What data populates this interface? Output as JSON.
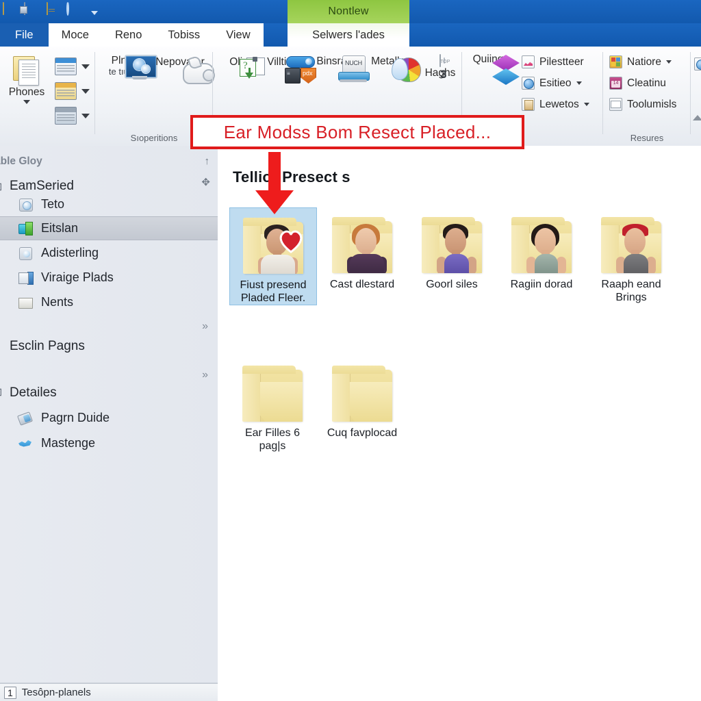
{
  "window": {
    "quick_access": [
      {
        "name": "folder-icon"
      },
      {
        "name": "properties-icon"
      },
      {
        "name": "document-icon"
      },
      {
        "name": "undo-icon"
      }
    ],
    "contextual_tab_header": "Nontlew"
  },
  "ribbon": {
    "tabs": [
      {
        "label": "File",
        "active": false,
        "style": "file"
      },
      {
        "label": "Moce",
        "active": false
      },
      {
        "label": "Reno",
        "active": false
      },
      {
        "label": "Tobiss",
        "active": false
      },
      {
        "label": "View",
        "active": false
      }
    ],
    "contextual_tab": {
      "label": "Selwers l'ades",
      "active": true
    },
    "groups": [
      {
        "label": "",
        "big_buttons": [
          {
            "label": "Phones",
            "has_caret": true,
            "icon": "document-stack-icon"
          }
        ],
        "stack_buttons": [
          {
            "icon": "window-blue-icon",
            "caret": true
          },
          {
            "icon": "window-yellow-icon",
            "caret": true
          },
          {
            "icon": "window-gray-icon",
            "caret": true
          }
        ]
      },
      {
        "label": "Sıoperitions",
        "big_buttons": [
          {
            "label": "Plnus",
            "sublabel": "te tıüriıs",
            "icon": "monitor-icon"
          },
          {
            "label": "Nepovator",
            "icon": "pig-icon"
          }
        ]
      },
      {
        "label": "",
        "big_buttons": [
          {
            "label": "Olin",
            "icon": "move-to-icon"
          },
          {
            "label": "Villtiom",
            "icon": "chip-icon"
          },
          {
            "label": "Binsraen",
            "icon": "sofa-icon"
          },
          {
            "label": "Metalles",
            "icon": "palette-icon"
          },
          {
            "label": "Haghs",
            "icon": "badge-3-icon"
          }
        ]
      },
      {
        "label": "",
        "big_buttons": [
          {
            "label": "Quiing",
            "icon": "diamonds-icon"
          }
        ],
        "small_buttons": [
          {
            "label": "Pilestteer",
            "icon": "chart-icon",
            "caret": false
          },
          {
            "label": "Esitieo",
            "icon": "globe-icon",
            "caret": true
          },
          {
            "label": "Lewetos",
            "icon": "page-icon",
            "caret": true
          }
        ]
      },
      {
        "label": "Resures",
        "small_buttons": [
          {
            "label": "Natiore",
            "icon": "grid-color-icon",
            "caret": true
          },
          {
            "label": "Cleatinu",
            "icon": "calendar-icon",
            "caret": false
          },
          {
            "label": "Toolumisls",
            "icon": "envelope-icon",
            "caret": false
          }
        ]
      }
    ]
  },
  "callout": {
    "text": "Ear Modss Bom Resect Placed...",
    "border_color": "#e01b1b",
    "text_color": "#d81f26"
  },
  "sidebar": {
    "header": "able Gloy",
    "root": {
      "label": "EamSeried",
      "glyph": "⊞"
    },
    "items": [
      {
        "label": "Teto",
        "icon": "disc-icon",
        "selected": false
      },
      {
        "label": "Eitslan",
        "icon": "network-drive-icon",
        "selected": true
      },
      {
        "label": "Adisterling",
        "icon": "disc-drive-icon",
        "selected": false
      },
      {
        "label": "Viraige Plads",
        "icon": "pc-icon",
        "selected": false
      },
      {
        "label": "Nents",
        "icon": "folder-icon",
        "selected": false
      }
    ],
    "sections": [
      {
        "label": "Esclin Pagns",
        "chevron": "»"
      },
      {
        "label": "Detailes",
        "glyph": "⊞",
        "chevron": "»"
      }
    ],
    "detail_items": [
      {
        "label": "Pagrn Duide",
        "icon": "eraser-icon"
      },
      {
        "label": "Mastenge",
        "icon": "bird-icon"
      }
    ],
    "scroll_glyphs": {
      "up": "↑",
      "move": "✥",
      "chev1": "»",
      "chev2": "»"
    }
  },
  "content": {
    "group_header": "Tellior Presect s",
    "items": [
      {
        "name": "Fiust presend Pladed Fleer.",
        "selected": true,
        "thumb": "sim-male-white-tank",
        "heart": true,
        "hair": "#2a2220",
        "skin": "#d9a98c",
        "shirt": "#e7e4de"
      },
      {
        "name": "Cast dlestard",
        "selected": false,
        "thumb": "sim-female-ginger",
        "hair": "#c77a3c",
        "skin": "#e6bfa2",
        "shirt": "#46304a"
      },
      {
        "name": "Goorl siles",
        "selected": false,
        "thumb": "sim-male-purple-tank",
        "hair": "#241c19",
        "skin": "#d3a486",
        "shirt": "#6d5fb5"
      },
      {
        "name": "Ragiin dorad",
        "selected": false,
        "thumb": "sim-female-bob",
        "hair": "#241a17",
        "skin": "#e3b594",
        "shirt": "#8fa39a"
      },
      {
        "name": "Raaph eand Brings",
        "selected": false,
        "thumb": "sim-female-redband",
        "hair": "#c1202c",
        "skin": "#dcae8e",
        "shirt": "#6f6f71"
      },
      {
        "name": "Ear Filles 6 pag|s",
        "selected": false,
        "thumb": "empty-folder"
      },
      {
        "name": "Cuq favplocad",
        "selected": false,
        "thumb": "empty-folder"
      }
    ]
  },
  "status_bar": {
    "count": "1",
    "text": "Tesôpn-planels"
  }
}
